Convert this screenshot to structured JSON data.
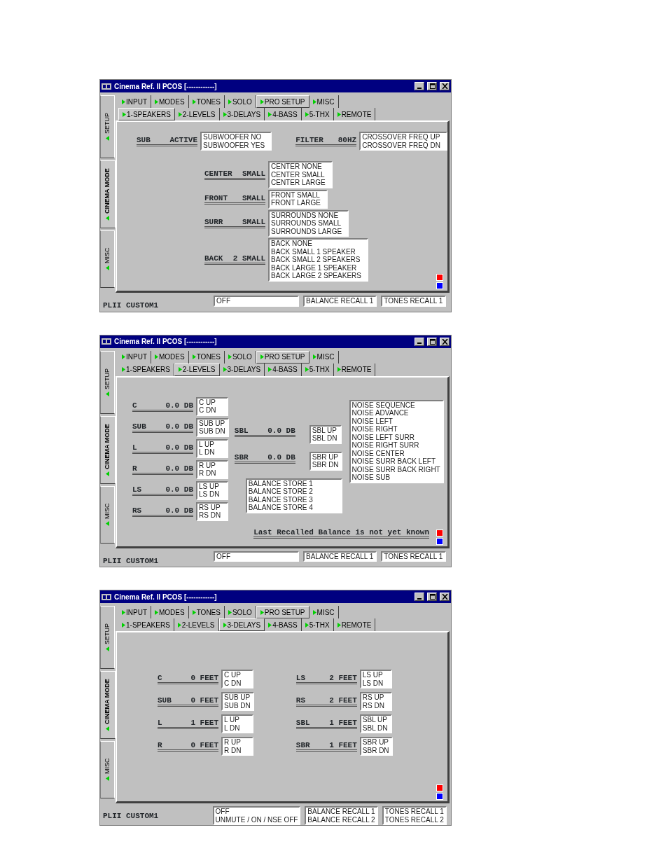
{
  "windows": [
    {
      "title": "Cinema Ref. II PCOS [------------]",
      "side_tabs": [
        {
          "label": "SETUP",
          "selected": false
        },
        {
          "label": "CINEMA MODE",
          "selected": true
        },
        {
          "label": "MISC",
          "selected": false
        }
      ],
      "tabs": [
        {
          "label": "INPUT",
          "selected": false
        },
        {
          "label": "MODES",
          "selected": false
        },
        {
          "label": "TONES",
          "selected": false
        },
        {
          "label": "SOLO",
          "selected": false
        },
        {
          "label": "PRO SETUP",
          "selected": true
        },
        {
          "label": "MISC",
          "selected": false
        }
      ],
      "subtabs": [
        {
          "label": "1-SPEAKERS",
          "selected": true
        },
        {
          "label": "2-LEVELS",
          "selected": false
        },
        {
          "label": "3-DELAYS",
          "selected": false
        },
        {
          "label": "4-BASS",
          "selected": false
        },
        {
          "label": "5-THX",
          "selected": false
        },
        {
          "label": "REMOTE",
          "selected": false
        }
      ],
      "page": {
        "kind": "rows",
        "sections": [
          [
            {
              "kind": "channel",
              "name": "SUB",
              "value": "ACTIVE",
              "options": [
                "SUBWOOFER NO",
                "SUBWOOFER YES"
              ]
            },
            {
              "kind": "channel",
              "name": "FILTER",
              "value": "80HZ",
              "options": [
                "CROSSOVER FREQ UP",
                "CROSSOVER FREQ DN"
              ]
            }
          ],
          [
            {
              "kind": "channel",
              "name": "CENTER",
              "value": "SMALL",
              "options": [
                "CENTER NONE",
                "CENTER SMALL",
                "CENTER LARGE"
              ]
            }
          ],
          [
            {
              "kind": "channel",
              "name": "FRONT",
              "value": "SMALL",
              "options": [
                "FRONT SMALL",
                "FRONT LARGE"
              ]
            }
          ],
          [
            {
              "kind": "channel",
              "name": "SURR",
              "value": "SMALL",
              "options": [
                "SURROUNDS NONE",
                "SURROUNDS SMALL",
                "SURROUNDS LARGE"
              ]
            }
          ],
          [
            {
              "kind": "channel",
              "name": "BACK",
              "value": "2 SMALL",
              "options": [
                "BACK NONE",
                "BACK SMALL 1 SPEAKER",
                "BACK SMALL 2 SPEAKERS",
                "BACK LARGE 1 SPEAKER",
                "BACK LARGE 2 SPEAKERS"
              ]
            }
          ]
        ]
      },
      "indicators": [
        {
          "color": "#ff0000"
        },
        {
          "color": "#0000ff"
        }
      ],
      "footer": {
        "mode": "PLII CUSTOM1",
        "lists": [
          [
            "OFF"
          ],
          [
            "BALANCE RECALL 1"
          ],
          [
            "TONES RECALL 1"
          ]
        ]
      }
    },
    {
      "title": "Cinema Ref. II PCOS [------------]",
      "side_tabs": [
        {
          "label": "SETUP",
          "selected": false
        },
        {
          "label": "CINEMA MODE",
          "selected": true
        },
        {
          "label": "MISC",
          "selected": false
        }
      ],
      "tabs": [
        {
          "label": "INPUT",
          "selected": false
        },
        {
          "label": "MODES",
          "selected": false
        },
        {
          "label": "TONES",
          "selected": false
        },
        {
          "label": "SOLO",
          "selected": false
        },
        {
          "label": "PRO SETUP",
          "selected": true
        },
        {
          "label": "MISC",
          "selected": false
        }
      ],
      "subtabs": [
        {
          "label": "1-SPEAKERS",
          "selected": false
        },
        {
          "label": "2-LEVELS",
          "selected": true
        },
        {
          "label": "3-DELAYS",
          "selected": false
        },
        {
          "label": "4-BASS",
          "selected": false
        },
        {
          "label": "5-THX",
          "selected": false
        },
        {
          "label": "REMOTE",
          "selected": false
        }
      ],
      "page": {
        "kind": "columns",
        "sections": [
          [
            {
              "kind": "channel",
              "name": "C",
              "value": "0.0 DB",
              "options": [
                "C UP",
                "C DN"
              ]
            },
            {
              "kind": "channel",
              "name": "SUB",
              "value": "0.0 DB",
              "options": [
                "SUB UP",
                "SUB DN"
              ]
            },
            {
              "kind": "channel",
              "name": "L",
              "value": "0.0 DB",
              "options": [
                "L UP",
                "L DN"
              ]
            },
            {
              "kind": "channel",
              "name": "R",
              "value": "0.0 DB",
              "options": [
                "R UP",
                "R DN"
              ]
            },
            {
              "kind": "channel",
              "name": "LS",
              "value": "0.0 DB",
              "options": [
                "LS UP",
                "LS DN"
              ]
            },
            {
              "kind": "channel",
              "name": "RS",
              "value": "0.0 DB",
              "options": [
                "RS UP",
                "RS DN"
              ]
            }
          ],
          [
            {
              "kind": "channel",
              "name": "SBL",
              "value": "0.0 DB",
              "options": [
                "SBL UP",
                "SBL DN"
              ]
            },
            {
              "kind": "channel",
              "name": "SBR",
              "value": "0.0 DB",
              "options": [
                "SBR UP",
                "SBR DN"
              ]
            },
            {
              "kind": "list",
              "options": [
                "BALANCE STORE 1",
                "BALANCE STORE 2",
                "BALANCE STORE 3",
                "BALANCE STORE 4"
              ]
            }
          ],
          [
            {
              "kind": "list",
              "options": [
                "NOISE SEQUENCE",
                "NOISE ADVANCE",
                "NOISE LEFT",
                "NOISE RIGHT",
                "NOISE LEFT SURR",
                "NOISE RIGHT SURR",
                "NOISE CENTER",
                "NOISE SURR BACK LEFT",
                "NOISE SURR BACK RIGHT",
                "NOISE SUB"
              ]
            }
          ]
        ]
      },
      "note": "Last Recalled Balance is not yet known",
      "indicators": [
        {
          "color": "#ff0000"
        },
        {
          "color": "#0000ff"
        }
      ],
      "footer": {
        "mode": "PLII CUSTOM1",
        "lists": [
          [
            "OFF"
          ],
          [
            "BALANCE RECALL 1"
          ],
          [
            "TONES RECALL 1"
          ]
        ]
      }
    },
    {
      "title": "Cinema Ref. II PCOS [------------]",
      "side_tabs": [
        {
          "label": "SETUP",
          "selected": false
        },
        {
          "label": "CINEMA MODE",
          "selected": true
        },
        {
          "label": "MISC",
          "selected": false
        }
      ],
      "tabs": [
        {
          "label": "INPUT",
          "selected": false
        },
        {
          "label": "MODES",
          "selected": false
        },
        {
          "label": "TONES",
          "selected": false
        },
        {
          "label": "SOLO",
          "selected": false
        },
        {
          "label": "PRO SETUP",
          "selected": true
        },
        {
          "label": "MISC",
          "selected": false
        }
      ],
      "subtabs": [
        {
          "label": "1-SPEAKERS",
          "selected": false
        },
        {
          "label": "2-LEVELS",
          "selected": false
        },
        {
          "label": "3-DELAYS",
          "selected": true
        },
        {
          "label": "4-BASS",
          "selected": false
        },
        {
          "label": "5-THX",
          "selected": false
        },
        {
          "label": "REMOTE",
          "selected": false
        }
      ],
      "page": {
        "kind": "columns",
        "sections": [
          [
            {
              "kind": "channel",
              "name": "C",
              "value": "0 FEET",
              "options": [
                "C UP",
                "C DN"
              ]
            },
            {
              "kind": "channel",
              "name": "SUB",
              "value": "0 FEET",
              "options": [
                "SUB UP",
                "SUB DN"
              ]
            },
            {
              "kind": "channel",
              "name": "L",
              "value": "1 FEET",
              "options": [
                "L UP",
                "L DN"
              ]
            },
            {
              "kind": "channel",
              "name": "R",
              "value": "0 FEET",
              "options": [
                "R UP",
                "R DN"
              ]
            }
          ],
          [
            {
              "kind": "channel",
              "name": "LS",
              "value": "2 FEET",
              "options": [
                "LS UP",
                "LS DN"
              ]
            },
            {
              "kind": "channel",
              "name": "RS",
              "value": "2 FEET",
              "options": [
                "RS UP",
                "RS DN"
              ]
            },
            {
              "kind": "channel",
              "name": "SBL",
              "value": "1 FEET",
              "options": [
                "SBL UP",
                "SBL DN"
              ]
            },
            {
              "kind": "channel",
              "name": "SBR",
              "value": "1 FEET",
              "options": [
                "SBR UP",
                "SBR DN"
              ]
            }
          ]
        ]
      },
      "indicators": [
        {
          "color": "#ff0000"
        },
        {
          "color": "#0000ff"
        }
      ],
      "footer": {
        "mode": "PLII CUSTOM1",
        "lists": [
          [
            "OFF",
            "UNMUTE / ON / NSE OFF"
          ],
          [
            "BALANCE RECALL 1",
            "BALANCE RECALL 2"
          ],
          [
            "TONES RECALL 1",
            "TONES RECALL 2"
          ]
        ]
      }
    }
  ]
}
